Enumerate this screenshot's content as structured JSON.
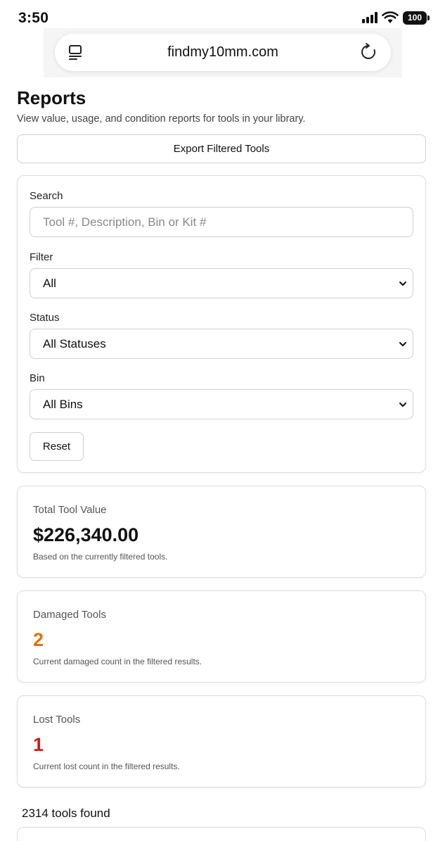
{
  "status_bar": {
    "time": "3:50",
    "battery": "100"
  },
  "browser": {
    "url": "findmy10mm.com"
  },
  "page": {
    "title": "Reports",
    "subtitle": "View value, usage, and condition reports for tools in your library.",
    "export_label": "Export Filtered Tools"
  },
  "filters": {
    "search_label": "Search",
    "search_placeholder": "Tool #, Description, Bin or Kit #",
    "filter_label": "Filter",
    "filter_value": "All",
    "status_label": "Status",
    "status_value": "All Statuses",
    "bin_label": "Bin",
    "bin_value": "All Bins",
    "reset_label": "Reset"
  },
  "stats": {
    "total_value": {
      "label": "Total Tool Value",
      "value": "$226,340.00",
      "note": "Based on the currently filtered tools.",
      "color": "#111111"
    },
    "damaged": {
      "label": "Damaged Tools",
      "value": "2",
      "note": "Current damaged count in the filtered results.",
      "color": "#e0730f"
    },
    "lost": {
      "label": "Lost Tools",
      "value": "1",
      "note": "Current lost count in the filtered results.",
      "color": "#d61a1a"
    }
  },
  "results": {
    "count_text": "2314 tools found"
  }
}
